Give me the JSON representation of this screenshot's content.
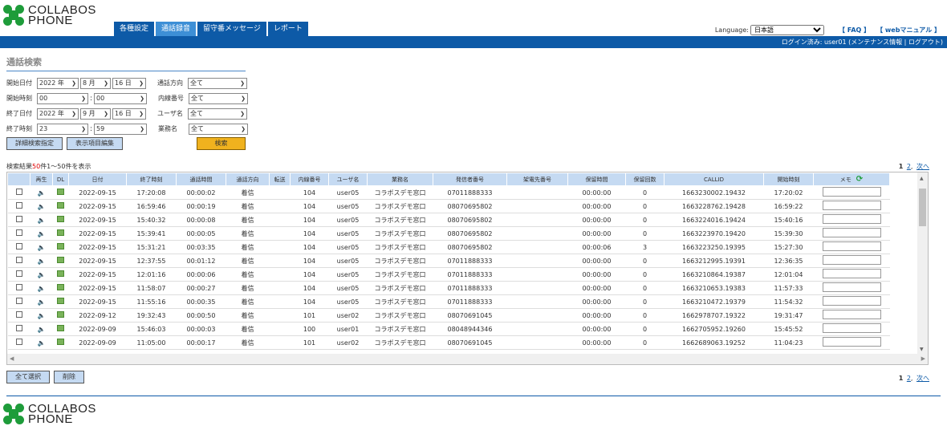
{
  "brand": {
    "line1": "COLLABOS",
    "line2": "PHONE"
  },
  "tabs": [
    "各種設定",
    "通話録音",
    "留守番メッセージ",
    "レポート"
  ],
  "active_tab": 1,
  "lang": {
    "label": "Language:",
    "value": "日本語",
    "faq": "【 FAQ 】",
    "manual": "【 webマニュアル 】"
  },
  "login": "ログイン済み: user01 (メンテナンス情報 | ログアウト)",
  "search": {
    "title": "通話検索",
    "start_date_label": "開始日付",
    "start_year": "2022 年",
    "start_month": "8 月",
    "start_day": "16 日",
    "start_time_label": "開始時刻",
    "start_hour": "00",
    "start_min": "00",
    "end_date_label": "終了日付",
    "end_year": "2022 年",
    "end_month": "9 月",
    "end_day": "16 日",
    "end_time_label": "終了時刻",
    "end_hour": "23",
    "end_min": "59",
    "direction_label": "通話方向",
    "direction_value": "全て",
    "ext_label": "内線番号",
    "ext_value": "全て",
    "user_label": "ユーザ名",
    "user_value": "全て",
    "biz_label": "業務名",
    "biz_value": "全て",
    "detail_btn": "詳細検索指定",
    "columns_btn": "表示項目編集",
    "search_btn": "検索"
  },
  "results": {
    "prefix": "検索結果",
    "count": "50",
    "suffix": "件1〜50件を表示",
    "page_current": "1",
    "page_next_num": "2",
    "page_next": "次へ"
  },
  "columns": [
    "",
    "再生",
    "DL",
    "日付",
    "終了時刻",
    "通話時間",
    "通話方向",
    "転送",
    "内線番号",
    "ユーザ名",
    "業務名",
    "発信者番号",
    "架電先番号",
    "保留時間",
    "保留回数",
    "CALLID",
    "開始時刻",
    "メモ"
  ],
  "rows": [
    [
      "2022-09-15",
      "17:20:08",
      "00:00:02",
      "着信",
      "",
      "104",
      "user05",
      "コラボスデモ窓口",
      "07011888333",
      "",
      "00:00:00",
      "0",
      "1663230002.19432",
      "17:20:02"
    ],
    [
      "2022-09-15",
      "16:59:46",
      "00:00:19",
      "着信",
      "",
      "104",
      "user05",
      "コラボスデモ窓口",
      "08070695802",
      "",
      "00:00:00",
      "0",
      "1663228762.19428",
      "16:59:22"
    ],
    [
      "2022-09-15",
      "15:40:32",
      "00:00:08",
      "着信",
      "",
      "104",
      "user05",
      "コラボスデモ窓口",
      "08070695802",
      "",
      "00:00:00",
      "0",
      "1663224016.19424",
      "15:40:16"
    ],
    [
      "2022-09-15",
      "15:39:41",
      "00:00:05",
      "着信",
      "",
      "104",
      "user05",
      "コラボスデモ窓口",
      "08070695802",
      "",
      "00:00:00",
      "0",
      "1663223970.19420",
      "15:39:30"
    ],
    [
      "2022-09-15",
      "15:31:21",
      "00:03:35",
      "着信",
      "",
      "104",
      "user05",
      "コラボスデモ窓口",
      "08070695802",
      "",
      "00:00:06",
      "3",
      "1663223250.19395",
      "15:27:30"
    ],
    [
      "2022-09-15",
      "12:37:55",
      "00:01:12",
      "着信",
      "",
      "104",
      "user05",
      "コラボスデモ窓口",
      "07011888333",
      "",
      "00:00:00",
      "0",
      "1663212995.19391",
      "12:36:35"
    ],
    [
      "2022-09-15",
      "12:01:16",
      "00:00:06",
      "着信",
      "",
      "104",
      "user05",
      "コラボスデモ窓口",
      "07011888333",
      "",
      "00:00:00",
      "0",
      "1663210864.19387",
      "12:01:04"
    ],
    [
      "2022-09-15",
      "11:58:07",
      "00:00:27",
      "着信",
      "",
      "104",
      "user05",
      "コラボスデモ窓口",
      "07011888333",
      "",
      "00:00:00",
      "0",
      "1663210653.19383",
      "11:57:33"
    ],
    [
      "2022-09-15",
      "11:55:16",
      "00:00:35",
      "着信",
      "",
      "104",
      "user05",
      "コラボスデモ窓口",
      "07011888333",
      "",
      "00:00:00",
      "0",
      "1663210472.19379",
      "11:54:32"
    ],
    [
      "2022-09-12",
      "19:32:43",
      "00:00:50",
      "着信",
      "",
      "101",
      "user02",
      "コラボスデモ窓口",
      "08070691045",
      "",
      "00:00:00",
      "0",
      "1662978707.19322",
      "19:31:47"
    ],
    [
      "2022-09-09",
      "15:46:03",
      "00:00:03",
      "着信",
      "",
      "100",
      "user01",
      "コラボスデモ窓口",
      "08048944346",
      "",
      "00:00:00",
      "0",
      "1662705952.19260",
      "15:45:52"
    ],
    [
      "2022-09-09",
      "11:05:00",
      "00:00:17",
      "着信",
      "",
      "101",
      "user02",
      "コラボスデモ窓口",
      "08070691045",
      "",
      "00:00:00",
      "0",
      "1662689063.19252",
      "11:04:23"
    ]
  ],
  "bottom": {
    "select_all": "全て選択",
    "delete": "削除"
  },
  "colors": {
    "primary": "#0d5aa7",
    "header_cell": "#c5daf2",
    "search_button": "#f0b21e",
    "logo_green": "#1e9c3a"
  }
}
